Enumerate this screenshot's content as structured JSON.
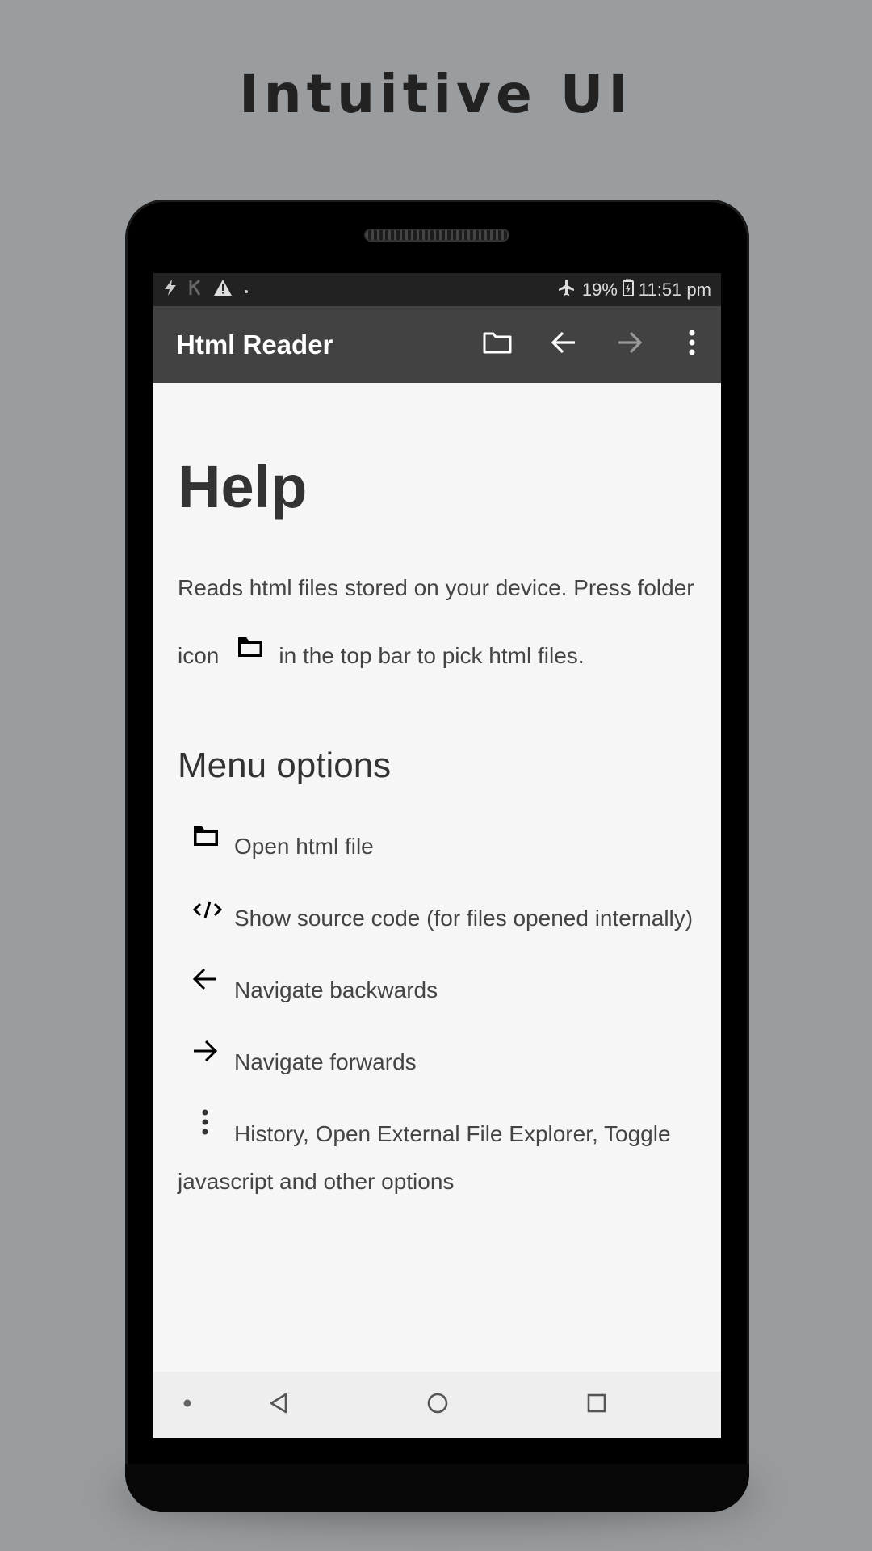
{
  "headline": "Intuitive UI",
  "status_bar": {
    "battery": "19%",
    "time": "11:51 pm"
  },
  "app_bar": {
    "title": "Html Reader",
    "actions": [
      "folder-icon",
      "arrow-back-icon",
      "arrow-forward-icon",
      "more-vert-icon"
    ]
  },
  "help": {
    "title": "Help",
    "intro_part1": "Reads html files stored on your device. Press folder icon",
    "intro_part2": "in the top bar to pick html files.",
    "menu_title": "Menu options",
    "options": [
      {
        "icon": "folder-icon",
        "label": "Open html file"
      },
      {
        "icon": "code-icon",
        "label": "Show source code (for files opened internally)"
      },
      {
        "icon": "arrow-back-icon",
        "label": "Navigate backwards"
      },
      {
        "icon": "arrow-forward-icon",
        "label": "Navigate forwards"
      },
      {
        "icon": "more-vert-icon",
        "label": "History, Open External File Explorer, Toggle javascript and other options"
      }
    ]
  },
  "colors": {
    "background": "#9a9da0",
    "app_bar": "#424242",
    "status_bar": "#222222",
    "screen": "#f6f6f6"
  }
}
